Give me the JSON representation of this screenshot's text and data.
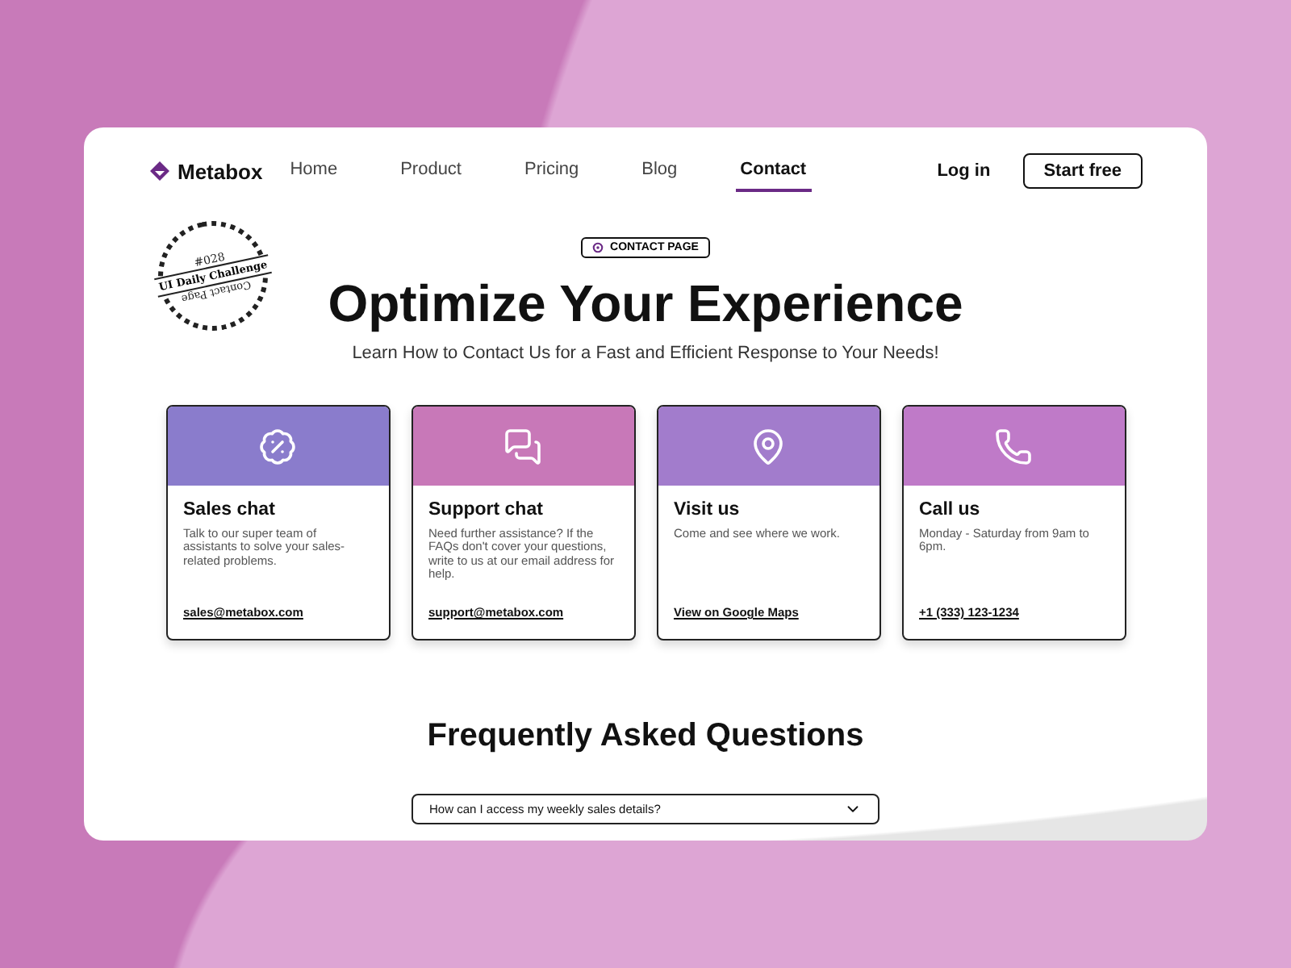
{
  "brand": {
    "name": "Metabox"
  },
  "nav": [
    {
      "label": "Home",
      "selected": false
    },
    {
      "label": "Product",
      "selected": false
    },
    {
      "label": "Pricing",
      "selected": false
    },
    {
      "label": "Blog",
      "selected": false
    },
    {
      "label": "Contact",
      "selected": true
    }
  ],
  "actions": {
    "login": "Log in",
    "signup": "Start free"
  },
  "stamp": {
    "number": "#028",
    "title": "UI Daily Challenge",
    "subtitle": "Contact Page"
  },
  "hero": {
    "tag": "CONTACT PAGE",
    "title": "Optimize Your Experience",
    "subtitle": "Learn How to Contact Us for a Fast and Efficient Response to Your Needs!"
  },
  "cards": [
    {
      "title": "Sales chat",
      "text": "Talk to our super team of assistants to solve your sales-related problems.",
      "link": "sales@metabox.com",
      "color": "#8a7ccc"
    },
    {
      "title": "Support chat",
      "text": "Need further assistance? If the FAQs don't cover your questions, write to us at our email address for help.",
      "link": "support@metabox.com",
      "color": "#c878b8"
    },
    {
      "title": "Visit us",
      "text": "Come and see where we work.",
      "link": "View on Google Maps",
      "color": "#a27ccc"
    },
    {
      "title": "Call us",
      "text": "Monday - Saturday from 9am to 6pm.",
      "link": "+1 (333) 123-1234",
      "color": "#bf7ac8"
    }
  ],
  "faq": {
    "title": "Frequently Asked Questions",
    "items": [
      {
        "question": "How can I access my weekly sales details?",
        "expanded": false
      }
    ]
  }
}
